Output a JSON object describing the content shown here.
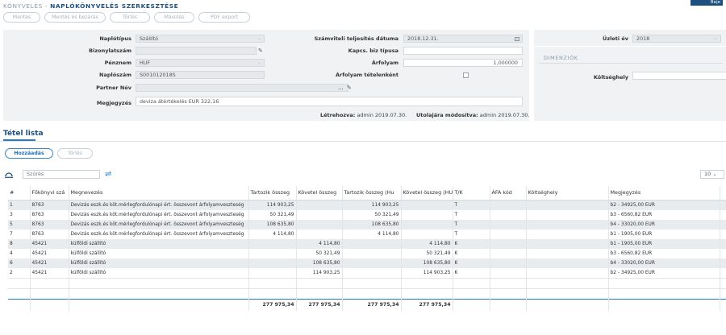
{
  "header": {
    "breadcrumb_prefix": "KÖNYVELÉS - ",
    "breadcrumb_current": "NAPLÓKÖNYVELÉS SZERKESZTÉSE",
    "user_button": "Beje",
    "buttons": [
      "Mentés",
      "Mentés és bezárás",
      "Törlés",
      "Másolás",
      "PDF export"
    ]
  },
  "form": {
    "labels": {
      "naplotipus": "Naplótípus",
      "bizonylatszam": "Bizonylatszám",
      "penznem": "Pénznem",
      "naploszam": "Naplószám",
      "partner_nev": "Partner Név",
      "megjegyzes": "Megjegyzés",
      "teljesites": "Számviteli teljesítés dátuma",
      "kapcs_biz": "Kapcs. biz típusa",
      "arfolyam": "Árfolyam",
      "arfolyam_tetelenkent": "Árfolyam tételenként",
      "uzleti_ev": "Üzleti év",
      "dimenziok": "DIMENZIÓK",
      "koltseghely": "Költséghely"
    },
    "values": {
      "naplotipus": "Szállító",
      "bizonylatszam": "",
      "penznem": "HUF",
      "naploszam": "S001012018S",
      "partner_nev": "",
      "partner_ellipsis": "...",
      "megjegyzes": "deviza átértékelés EUR 322,16",
      "teljesites": "2018.12.31.",
      "kapcs_biz": "",
      "arfolyam": "1,000000",
      "uzleti_ev": "2018",
      "koltseghely": ""
    },
    "meta": {
      "letrehozva_label": "Létrehozva:",
      "letrehozva_value": "admin 2019.07.30.",
      "modositva_label": "Utolajára módosítva:",
      "modositva_value": "admin 2019.07.30."
    }
  },
  "tetel_lista": {
    "title": "Tétel lista",
    "buttons": [
      "Hozzáadás",
      "Törlés"
    ],
    "filter_placeholder": "Szűrés",
    "page_size": "10",
    "columns": [
      "#",
      "Főkönyvi szá",
      "Megnevezés",
      "Tartozik összeg",
      "Követel összeg",
      "Tartozik összeg (Hu",
      "Követel összeg (HU",
      "T/K",
      "ÁFA kód",
      "Költséghely",
      "Megjegyzés",
      ""
    ],
    "rows": [
      [
        "1",
        "8763",
        "Devizás eszk.és köt.mérlegfordulónapi ért. összevont árfolyamveszteség",
        "114 903,25",
        "",
        "114 903,25",
        "",
        "T",
        "",
        "",
        "b2 - 34925,00 EUR"
      ],
      [
        "3",
        "8763",
        "Devizás eszk.és köt.mérlegfordulónapi ért. összevont árfolyamveszteség",
        "50 321,49",
        "",
        "50 321,49",
        "",
        "T",
        "",
        "",
        "b3 - 6560,82 EUR"
      ],
      [
        "5",
        "8763",
        "Devizás eszk.és köt.mérlegfordulónapi ért. összevont árfolyamveszteség",
        "108 635,80",
        "",
        "108 635,80",
        "",
        "T",
        "",
        "",
        "b4 - 33020,00 EUR"
      ],
      [
        "7",
        "8763",
        "Devizás eszk.és köt.mérlegfordulónapi ért. összevont árfolyamveszteség",
        "4 114,80",
        "",
        "4 114,80",
        "",
        "T",
        "",
        "",
        "b1 - 1905,00 EUR"
      ],
      [
        "8",
        "45421",
        "külföldi szállító",
        "",
        "4 114,80",
        "",
        "4 114,80",
        "K",
        "",
        "",
        "b1 - 1905,00 EUR"
      ],
      [
        "4",
        "45421",
        "külföldi szállító",
        "",
        "50 321,49",
        "",
        "50 321,49",
        "K",
        "",
        "",
        "b3 - 6560,82 EUR"
      ],
      [
        "6",
        "45421",
        "külföldi szállító",
        "",
        "108 635,80",
        "",
        "108 635,80",
        "K",
        "",
        "",
        "b4 - 33020,00 EUR"
      ],
      [
        "2",
        "45421",
        "külföldi szállító",
        "",
        "114 903,25",
        "",
        "114 903,25",
        "K",
        "",
        "",
        "b2 - 34925,00 EUR"
      ]
    ],
    "totals": [
      "277 975,34",
      "277 975,34",
      "277 975,34",
      "277 975,34"
    ]
  },
  "icons": {
    "edit": "pencil-icon",
    "filter": "filter-icon",
    "swap": "swap-icon",
    "calendar": "calendar-icon"
  },
  "colors": {
    "primary": "#1d4f80",
    "accent": "#2a7bc4",
    "panel": "#f0f2f4"
  }
}
